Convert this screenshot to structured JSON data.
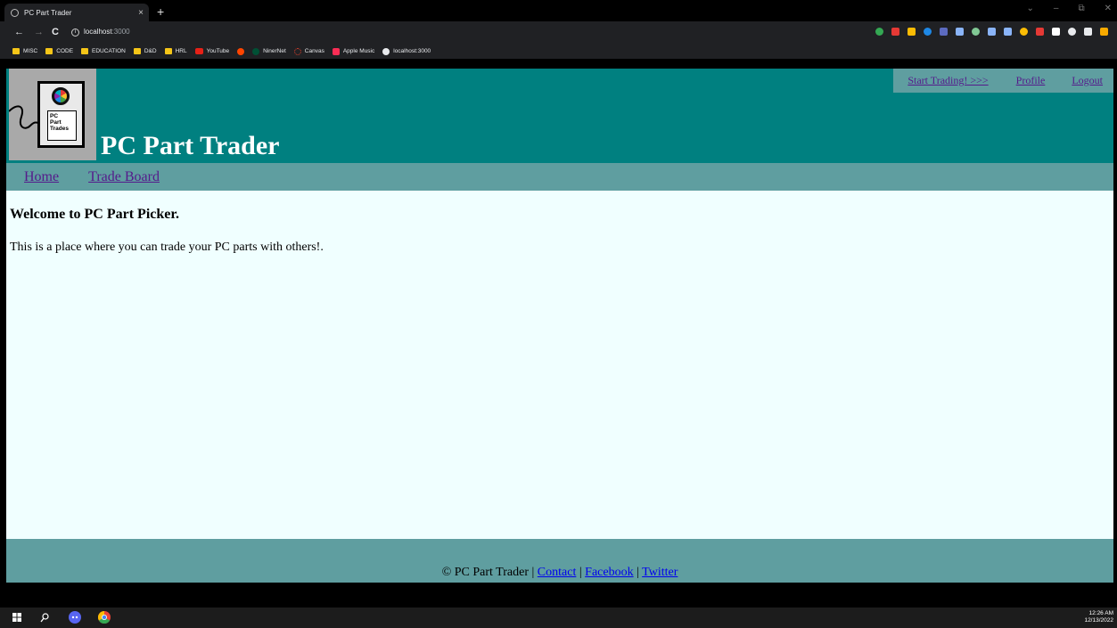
{
  "browser": {
    "tab_title": "PC Part Trader",
    "tab_close": "×",
    "new_tab": "+",
    "url_host": "localhost",
    "url_port": ":3000",
    "nav": {
      "back": "←",
      "forward": "→",
      "reload": "C"
    },
    "window_controls": {
      "chevron": "⌄",
      "minimize": "–",
      "restore": "⧉",
      "close": "✕"
    },
    "bookmarks": [
      "MISC",
      "CODE",
      "EDUCATION",
      "D&D",
      "HRL",
      "YouTube",
      "",
      "NinerNet",
      "Canvas",
      "Apple Music",
      "localhost:3000"
    ],
    "extension_colors": [
      "#34a853",
      "#e53935",
      "#fbbc04",
      "#1e88e5",
      "#5c6bc0",
      "#8ab4f8",
      "#81c995",
      "#8ab4f8",
      "#8ab4f8",
      "#fbbc04",
      "#e53935",
      "#ffffff",
      "#e8eaed",
      "#e8eaed",
      "#f9ab00"
    ]
  },
  "site": {
    "title": "PC Part Trader",
    "logo_text": [
      "PC",
      "Part",
      "Trades"
    ],
    "user_nav": {
      "start_trading": "Start Trading! >>>",
      "profile": "Profile",
      "logout": "Logout"
    },
    "main_nav": {
      "home": "Home",
      "trade_board": "Trade Board"
    },
    "welcome_heading": "Welcome to PC Part Picker.",
    "welcome_text": "This is a place where you can trade your PC parts with others!.",
    "footer": {
      "copyright": "© PC Part Trader",
      "separator": "|",
      "contact": "Contact",
      "facebook": "Facebook",
      "twitter": "Twitter"
    }
  },
  "colors": {
    "header": "#008080",
    "nav": "#5f9ea0",
    "page_bg": "#f0ffff",
    "visited_link": "#551a8b",
    "link": "#0000ee"
  },
  "taskbar": {
    "time": "12:26 AM",
    "date": "12/13/2022"
  }
}
